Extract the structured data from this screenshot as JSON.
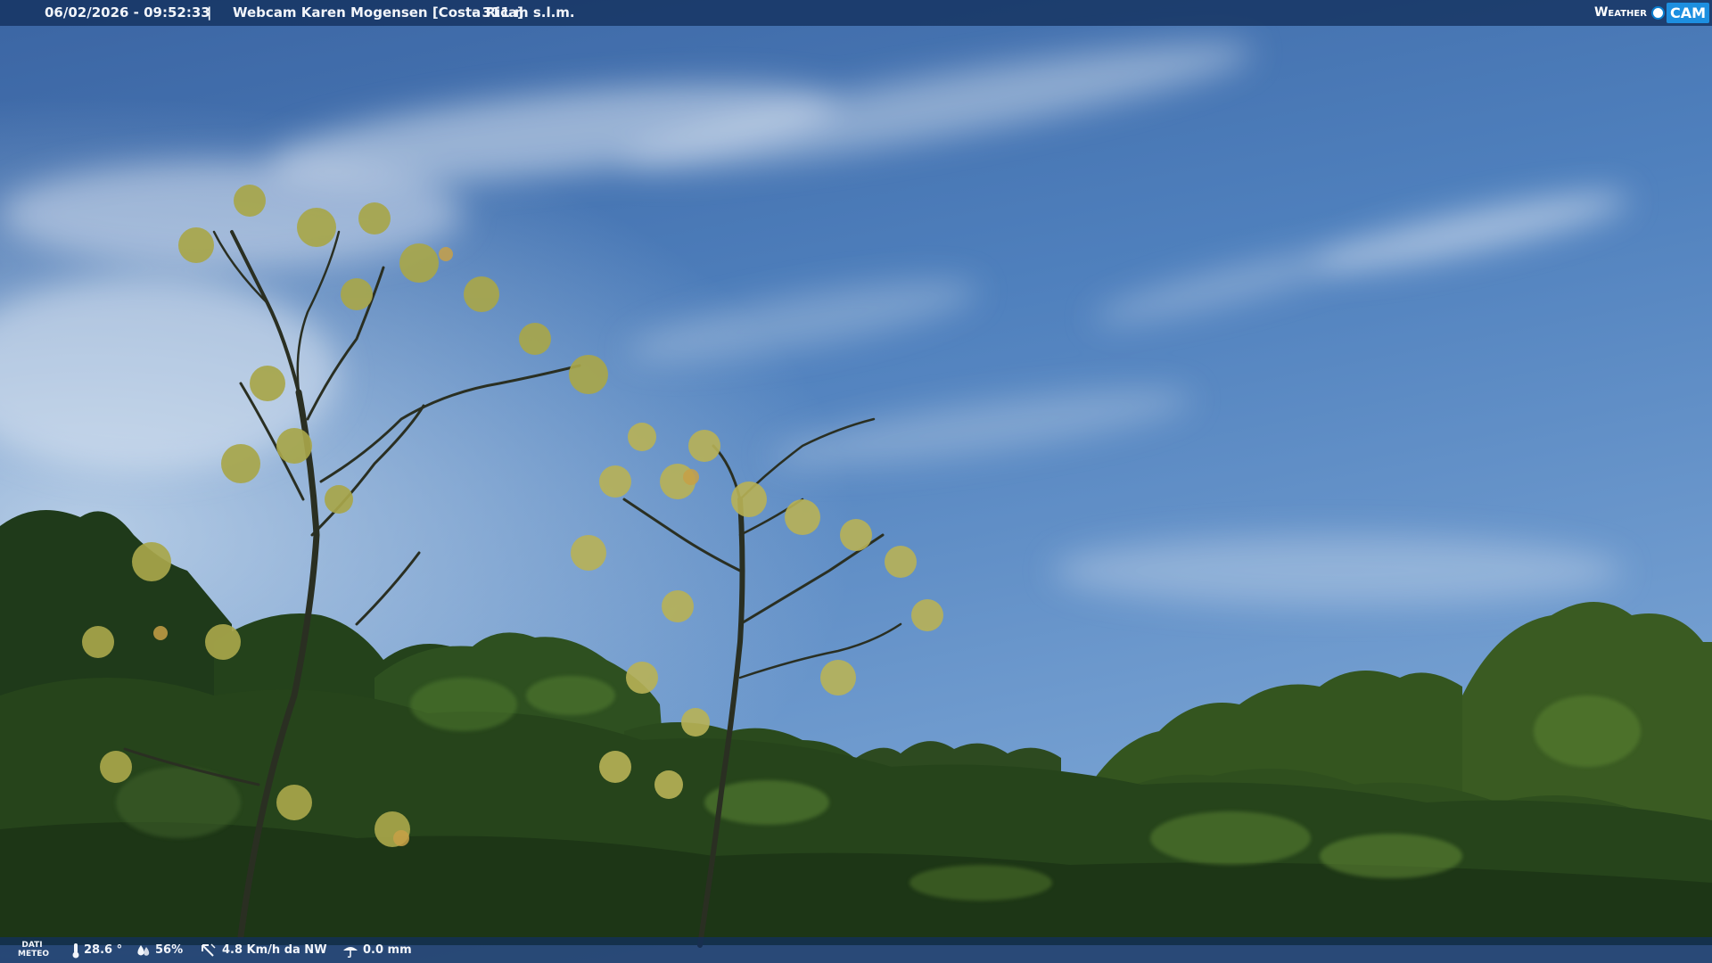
{
  "overlay_top": {
    "timestamp": "06/02/2026 - 09:52:33",
    "separator": "|",
    "title": "Webcam Karen Mogensen [Costa Rica]",
    "altitude": "- 311 m s.l.m."
  },
  "logo": {
    "weather": "Weather",
    "cam": "CAM"
  },
  "overlay_bottom": {
    "label_line1": "DATI",
    "label_line2": "METEO",
    "temperature": "28.6 °",
    "humidity": "56%",
    "wind": "4.8 Km/h da NW",
    "rain": "0.0 mm"
  },
  "colors": {
    "sky_top": "#3d6aa9",
    "sky_bottom": "#6b98cf",
    "foliage_dark": "#1e3a18",
    "foliage_mid": "#3d6226",
    "leaf_light": "#b9b04a",
    "bar_bg": "#12305c",
    "logo_blue": "#1d8fe0"
  },
  "icons": [
    "thermometer-icon",
    "humidity-drop-icon",
    "wind-icon",
    "rain-icon"
  ]
}
